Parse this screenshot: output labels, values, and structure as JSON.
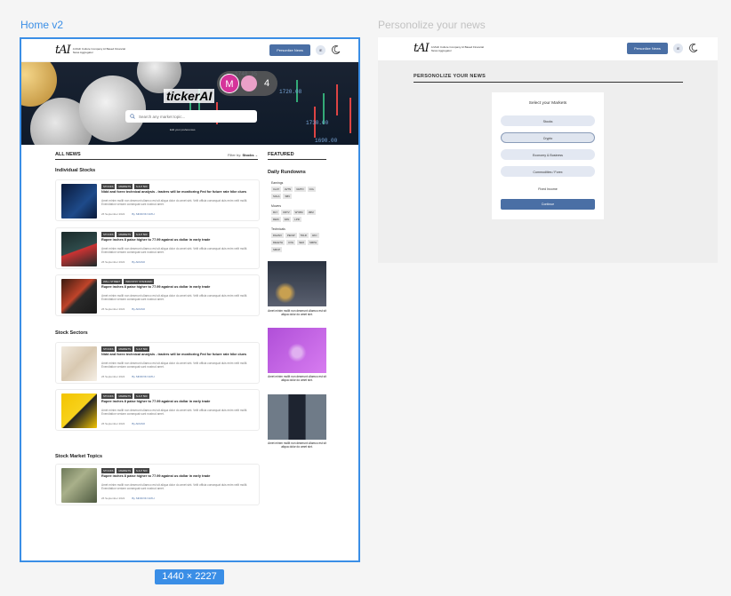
{
  "frames": {
    "home_label": "Home v2",
    "personalize_label": "Personolize your news",
    "dimensions": "1440 × 2227"
  },
  "header": {
    "logo": "tAI",
    "tagline": "A Moth Culture Company AI Based Financial News Aggregator",
    "personalize_button": "Personlize News",
    "lang": "IE"
  },
  "hero": {
    "brand": "tickerAI",
    "search_placeholder": "Search any market topic...",
    "hint": "Edit your preferences",
    "collab_initial": "M",
    "collab_count": "4"
  },
  "news": {
    "section_title": "ALL NEWS",
    "filter_label": "Filter by:",
    "filter_value": "Stocks",
    "featured_title": "FEATURED",
    "categories": [
      {
        "name": "Individual Stocks",
        "cards": [
          {
            "tags": [
              "STOCKS",
              "MARKETS",
              "S & P 500"
            ],
            "title": "Nidd and forex technical analysis - traders will be monitoring Fed for future rate hike clues",
            "body": "Amet minim mollit non deserunt ullamco est sit aliqua dolor do amet sint. Velit officia consequat duis enim velit mollit. Exercitation veniam consequat sunt nostrud amet.",
            "date": "26 September 2022",
            "author": "SIDDVIK NATH"
          },
          {
            "tags": [
              "STOCKS",
              "MARKETS",
              "S & P 500"
            ],
            "title": "Rupee inches 8 paise higher to 77.99 against us dollar in early trade",
            "body": "Amet minim mollit non deserunt ullamco est sit aliqua dolor do amet sint. Velit officia consequat duis enim velit mollit. Exercitation veniam consequat sunt nostrud amet.",
            "date": "26 September 2022",
            "author": "ARASO"
          },
          {
            "tags": [
              "WALL STREET",
              "INDUSTRY STANDARD"
            ],
            "title": "Rupee inches 8 paise higher to 77.99 against us dollar in early trade",
            "body": "Amet minim mollit non deserunt ullamco est sit aliqua dolor do amet sint. Velit officia consequat duis enim velit mollit. Exercitation veniam consequat sunt nostrud amet.",
            "date": "26 September 2022",
            "author": "ARASO"
          }
        ]
      },
      {
        "name": "Stock Sectors",
        "cards": [
          {
            "tags": [
              "STOCKS",
              "MARKETS",
              "S & P 500"
            ],
            "title": "Nidd and forex technical analysis - traders will be monitoring Fed for future rate hike clues",
            "body": "Amet minim mollit non deserunt ullamco est sit aliqua dolor do amet sint. Velit officia consequat duis enim velit mollit. Exercitation veniam consequat sunt nostrud amet.",
            "date": "26 September 2022",
            "author": "SIDDVIK NATH"
          },
          {
            "tags": [
              "STOCKS",
              "MARKETS",
              "S & P 500"
            ],
            "title": "Rupee inches 8 paise higher to 77.99 against us dollar in early trade",
            "body": "Amet minim mollit non deserunt ullamco est sit aliqua dolor do amet sint. Velit officia consequat duis enim velit mollit. Exercitation veniam consequat sunt nostrud amet.",
            "date": "26 September 2022",
            "author": "ARASO"
          }
        ]
      },
      {
        "name": "Stock Market Topics",
        "cards": [
          {
            "tags": [
              "STOCKS",
              "MARKETS",
              "S & P 500"
            ],
            "title": "Rupee inches 8 paise higher to 77.99 against us dollar in early trade",
            "body": "Amet minim mollit non deserunt ullamco est sit aliqua dolor do amet sint. Velit officia consequat duis enim velit mollit. Exercitation veniam consequat sunt nostrud amet.",
            "date": "26 September 2022",
            "author": "SIDDVIK NATH"
          }
        ]
      }
    ]
  },
  "rundowns": {
    "title": "Daily Rundowns",
    "groups": [
      {
        "label": "Earnings",
        "chips": [
          "CLAT",
          "AVTN",
          "GMTO",
          "CCL",
          "SOLA",
          "SBV"
        ]
      },
      {
        "label": "Movers",
        "chips": [
          "RLY",
          "KRTV",
          "WYRM",
          "JMM",
          "REIN",
          "KZN",
          "LPR"
        ]
      },
      {
        "label": "Technicals",
        "chips": [
          "DGANV",
          "PEOW",
          "TDLR",
          "AKC",
          "DELETH",
          "UXG",
          "SEO",
          "SMPH",
          "SMCP"
        ]
      }
    ],
    "featured_caption": "Amet minim mollit non deserunt ullamco est sit aliqua dolor do amet sint."
  },
  "personalize": {
    "title": "PERSONOLIZE YOUR NEWS",
    "panel_title": "Select your  Markets",
    "options": [
      "Stocks",
      "Crypto",
      "Economy & Business",
      "Commodities / Forex",
      "Fixed Income"
    ],
    "continue": "Continue"
  }
}
